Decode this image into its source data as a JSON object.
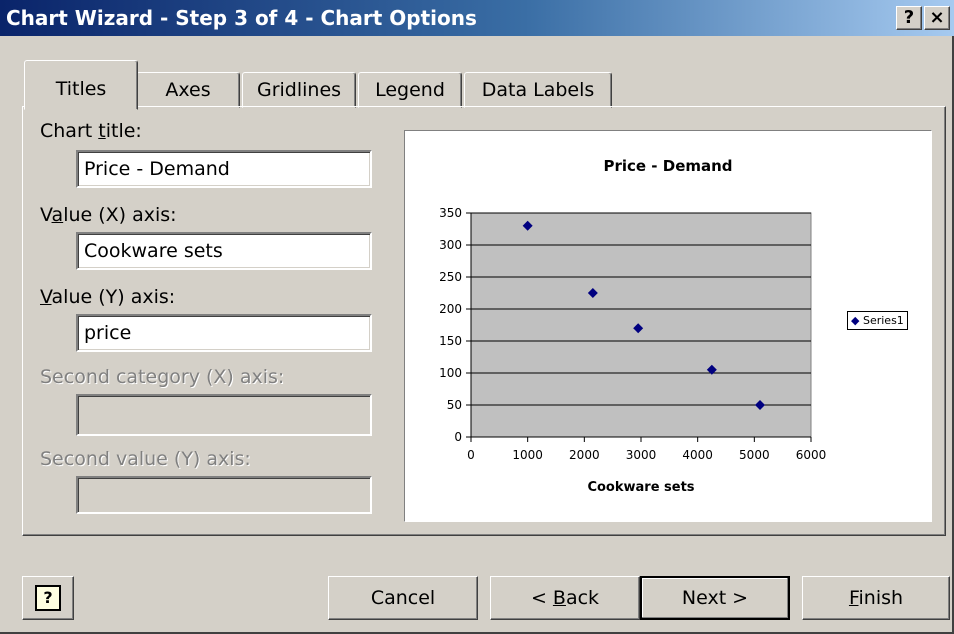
{
  "window": {
    "title": "Chart Wizard - Step 3 of 4 - Chart Options",
    "help_label": "?",
    "close_label": "×"
  },
  "tabs": [
    {
      "label": "Titles",
      "active": true
    },
    {
      "label": "Axes",
      "active": false
    },
    {
      "label": "Gridlines",
      "active": false
    },
    {
      "label": "Legend",
      "active": false
    },
    {
      "label": "Data Labels",
      "active": false
    }
  ],
  "fields": {
    "chart_title": {
      "label_pre": "Chart ",
      "label_u": "t",
      "label_post": "itle:",
      "value": "Price - Demand"
    },
    "value_x": {
      "label_pre": "V",
      "label_u": "a",
      "label_post": "lue (X) axis:",
      "value": "Cookware sets"
    },
    "value_y": {
      "label_pre": "",
      "label_u": "V",
      "label_post": "alue (Y) axis:",
      "value": "price"
    },
    "second_cat_x": {
      "label": "Second category (X) axis:",
      "value": ""
    },
    "second_val_y": {
      "label": "Second value (Y) axis:",
      "value": ""
    }
  },
  "buttons": {
    "help_icon": "?",
    "cancel": "Cancel",
    "back_pre": "< ",
    "back_u": "B",
    "back_post": "ack",
    "next": "Next >",
    "finish_u": "F",
    "finish_post": "inish"
  },
  "colors": {
    "title_start": "#0a246a",
    "title_end": "#a6caf0",
    "plot_area": "#c0c0c0",
    "marker": "#000080"
  },
  "chart_data": {
    "type": "scatter",
    "title": "Price - Demand",
    "xlabel": "Cookware sets",
    "ylabel": "",
    "xlim": [
      0,
      6000
    ],
    "ylim": [
      0,
      350
    ],
    "xticks": [
      0,
      1000,
      2000,
      3000,
      4000,
      5000,
      6000
    ],
    "yticks": [
      0,
      50,
      100,
      150,
      200,
      250,
      300,
      350
    ],
    "grid": true,
    "legend": "right",
    "series": [
      {
        "name": "Series1",
        "x": [
          1000,
          2150,
          2950,
          4250,
          5100
        ],
        "y": [
          330,
          225,
          170,
          105,
          50
        ]
      }
    ]
  }
}
